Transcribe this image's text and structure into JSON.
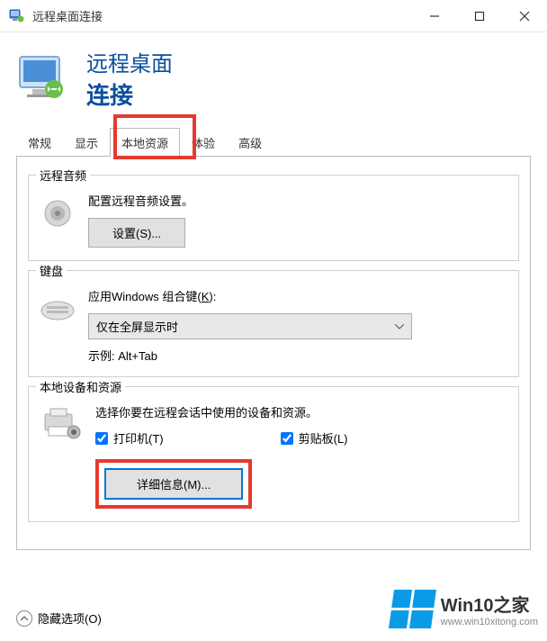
{
  "window": {
    "title": "远程桌面连接"
  },
  "header": {
    "line1": "远程桌面",
    "line2": "连接"
  },
  "tabs": {
    "items": [
      "常规",
      "显示",
      "本地资源",
      "体验",
      "高级"
    ],
    "active_index": 2
  },
  "audio": {
    "title": "远程音频",
    "desc": "配置远程音频设置。",
    "settings_btn": "设置(S)..."
  },
  "keyboard": {
    "title": "键盘",
    "desc_prefix": "应用Windows 组合键(",
    "desc_key": "K",
    "desc_suffix": "):",
    "select_value": "仅在全屏显示时",
    "example": "示例: Alt+Tab"
  },
  "devices": {
    "title": "本地设备和资源",
    "desc": "选择你要在远程会话中使用的设备和资源。",
    "printer_label": "打印机(T)",
    "printer_checked": true,
    "clipboard_label": "剪贴板(L)",
    "clipboard_checked": true,
    "details_btn": "详细信息(M)..."
  },
  "footer": {
    "hide_options": "隐藏选项(O)"
  },
  "watermark": {
    "brand": "Win10之家",
    "url": "www.win10xitong.com"
  }
}
